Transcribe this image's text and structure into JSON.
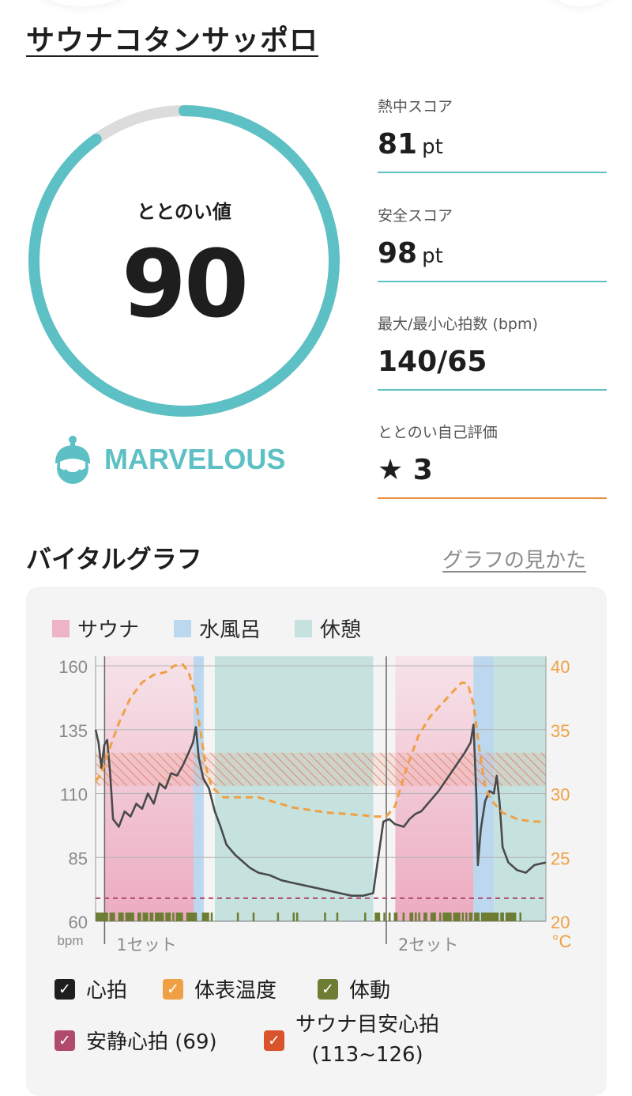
{
  "facility": {
    "name": "サウナコタンサッポロ"
  },
  "score": {
    "label": "ととのい値",
    "value": "90",
    "ratio": 0.9,
    "rank": "MARVELOUS"
  },
  "metrics": [
    {
      "label": "熱中スコア",
      "value": "81",
      "unit": "pt"
    },
    {
      "label": "安全スコア",
      "value": "98",
      "unit": "pt"
    },
    {
      "label": "最大/最小心拍数 (bpm)",
      "value": "140/65",
      "unit": ""
    },
    {
      "label": "ととのい自己評価",
      "value": "★ 3",
      "unit": ""
    }
  ],
  "vital_graph": {
    "title": "バイタルグラフ",
    "help_link": "グラフの見かた",
    "phase_legend": [
      {
        "label": "サウナ",
        "color": "#eeb3c6"
      },
      {
        "label": "水風呂",
        "color": "#bcd8ef"
      },
      {
        "label": "休憩",
        "color": "#c6e2de"
      }
    ],
    "toggles": [
      {
        "label": "心拍",
        "color": "#1e1e1e",
        "checked": true
      },
      {
        "label": "体表温度",
        "color": "#f0a044",
        "checked": true
      },
      {
        "label": "体動",
        "color": "#6d7d33",
        "checked": true
      },
      {
        "label": "安静心拍 (69)",
        "color": "#b04a6e",
        "checked": true
      },
      {
        "label": "サウナ目安心拍",
        "label2": "(113~126)",
        "color": "#d9542c",
        "checked": true
      }
    ]
  },
  "chart_data": {
    "type": "line",
    "y_left": {
      "label": "bpm",
      "ticks": [
        "160",
        "135",
        "110",
        "85",
        "60"
      ],
      "range": [
        60,
        160
      ]
    },
    "y_right": {
      "label": "°C",
      "ticks": [
        "40",
        "35",
        "30",
        "25",
        "20"
      ],
      "range": [
        20,
        40
      ]
    },
    "x_labels": [
      "1セット",
      "2セット"
    ],
    "phases": [
      {
        "type": "sauna",
        "start": 0.031,
        "end": 0.337
      },
      {
        "type": "cold",
        "start": 0.337,
        "end": 0.372
      },
      {
        "type": "rest",
        "start": 0.41,
        "end": 0.955
      },
      {
        "type": "sauna",
        "start": 1.031,
        "end": 1.3
      },
      {
        "type": "cold",
        "start": 1.3,
        "end": 1.37
      },
      {
        "type": "rest",
        "start": 1.37,
        "end": 1.549
      }
    ],
    "resting_hr": 69,
    "sauna_target_hr": [
      113,
      126
    ],
    "heart_rate": [
      [
        0,
        135
      ],
      [
        0.01,
        130
      ],
      [
        0.02,
        120
      ],
      [
        0.03,
        129
      ],
      [
        0.04,
        131
      ],
      [
        0.05,
        118
      ],
      [
        0.06,
        100
      ],
      [
        0.08,
        97
      ],
      [
        0.1,
        103
      ],
      [
        0.12,
        101
      ],
      [
        0.14,
        106
      ],
      [
        0.16,
        104
      ],
      [
        0.18,
        110
      ],
      [
        0.2,
        106
      ],
      [
        0.22,
        114
      ],
      [
        0.24,
        112
      ],
      [
        0.26,
        118
      ],
      [
        0.28,
        117
      ],
      [
        0.3,
        121
      ],
      [
        0.32,
        126
      ],
      [
        0.335,
        130
      ],
      [
        0.345,
        136
      ],
      [
        0.355,
        124
      ],
      [
        0.37,
        116
      ],
      [
        0.39,
        112
      ],
      [
        0.41,
        103
      ],
      [
        0.43,
        97
      ],
      [
        0.45,
        90
      ],
      [
        0.48,
        86
      ],
      [
        0.5,
        84
      ],
      [
        0.53,
        81
      ],
      [
        0.56,
        79
      ],
      [
        0.6,
        78
      ],
      [
        0.64,
        76
      ],
      [
        0.68,
        75
      ],
      [
        0.72,
        74
      ],
      [
        0.76,
        73
      ],
      [
        0.8,
        72
      ],
      [
        0.84,
        71
      ],
      [
        0.88,
        70
      ],
      [
        0.92,
        70
      ],
      [
        0.955,
        71
      ],
      [
        0.97,
        83
      ],
      [
        0.99,
        99
      ],
      [
        1.01,
        100
      ],
      [
        1.03,
        98
      ],
      [
        1.06,
        97
      ],
      [
        1.08,
        100
      ],
      [
        1.1,
        102
      ],
      [
        1.12,
        103
      ],
      [
        1.15,
        107
      ],
      [
        1.18,
        111
      ],
      [
        1.21,
        116
      ],
      [
        1.24,
        121
      ],
      [
        1.27,
        126
      ],
      [
        1.29,
        130
      ],
      [
        1.3,
        137
      ],
      [
        1.31,
        108
      ],
      [
        1.315,
        82
      ],
      [
        1.325,
        96
      ],
      [
        1.34,
        107
      ],
      [
        1.355,
        111
      ],
      [
        1.37,
        110
      ],
      [
        1.38,
        117
      ],
      [
        1.39,
        106
      ],
      [
        1.4,
        89
      ],
      [
        1.42,
        83
      ],
      [
        1.45,
        80
      ],
      [
        1.48,
        79
      ],
      [
        1.51,
        82
      ],
      [
        1.549,
        83
      ]
    ],
    "skin_temp": [
      [
        0,
        31
      ],
      [
        0.02,
        31.5
      ],
      [
        0.04,
        33
      ],
      [
        0.08,
        35.5
      ],
      [
        0.12,
        37.5
      ],
      [
        0.16,
        38.7
      ],
      [
        0.2,
        39.3
      ],
      [
        0.24,
        39.5
      ],
      [
        0.27,
        40
      ],
      [
        0.3,
        40.1
      ],
      [
        0.32,
        39.5
      ],
      [
        0.34,
        38
      ],
      [
        0.36,
        35
      ],
      [
        0.38,
        32
      ],
      [
        0.4,
        30.5
      ],
      [
        0.44,
        29.7
      ],
      [
        0.5,
        29.7
      ],
      [
        0.56,
        29.7
      ],
      [
        0.62,
        29.3
      ],
      [
        0.68,
        28.9
      ],
      [
        0.74,
        28.7
      ],
      [
        0.8,
        28.5
      ],
      [
        0.86,
        28.4
      ],
      [
        0.92,
        28.3
      ],
      [
        0.96,
        28.2
      ],
      [
        1.0,
        28.2
      ],
      [
        1.03,
        29
      ],
      [
        1.07,
        32
      ],
      [
        1.11,
        34.5
      ],
      [
        1.15,
        36
      ],
      [
        1.19,
        37
      ],
      [
        1.23,
        38
      ],
      [
        1.26,
        38.7
      ],
      [
        1.28,
        38.6
      ],
      [
        1.3,
        37
      ],
      [
        1.32,
        33.5
      ],
      [
        1.34,
        30.5
      ],
      [
        1.36,
        29.5
      ],
      [
        1.4,
        28.5
      ],
      [
        1.45,
        28
      ],
      [
        1.5,
        27.8
      ],
      [
        1.549,
        27.8
      ]
    ]
  }
}
